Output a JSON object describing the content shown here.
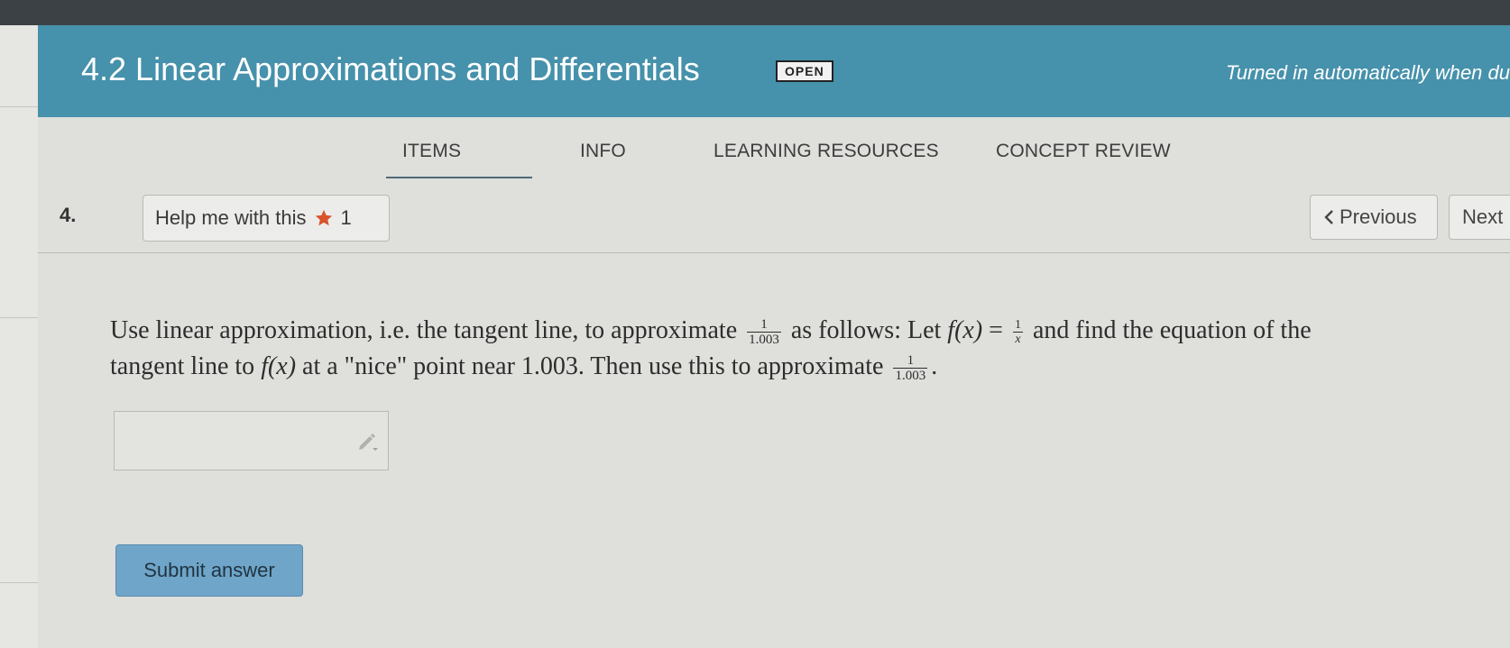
{
  "header": {
    "title": "4.2 Linear Approximations and Differentials",
    "badge": "OPEN",
    "turned_in": "Turned in automatically when du"
  },
  "tabs": [
    {
      "label": "ITEMS",
      "active": true
    },
    {
      "label": "INFO",
      "active": false
    },
    {
      "label": "LEARNING RESOURCES",
      "active": false
    },
    {
      "label": "CONCEPT REVIEW",
      "active": false
    }
  ],
  "question": {
    "number": "4.",
    "help_label": "Help me with this",
    "help_count": "1",
    "prev_label": "Previous",
    "next_label": "Next",
    "text": {
      "p1": "Use linear approximation, i.e. the tangent line, to approximate",
      "p2": "as follows: Let",
      "fx": "f(x)",
      "eq": "=",
      "p3": "and find the equation of the",
      "p4": "tangent line to",
      "p5": "at a \"nice\" point near 1.003. Then use this to approximate",
      "p6": ".",
      "frac1_num": "1",
      "frac1_den": "1.003",
      "frac2_num": "1",
      "frac2_den": "x"
    },
    "submit_label": "Submit answer"
  },
  "colors": {
    "header_bg": "#4691ab",
    "star": "#d9532b",
    "submit_bg": "#6fa5c8"
  },
  "icons": [
    "star-icon",
    "chevron-left-icon",
    "pencil-icon"
  ]
}
